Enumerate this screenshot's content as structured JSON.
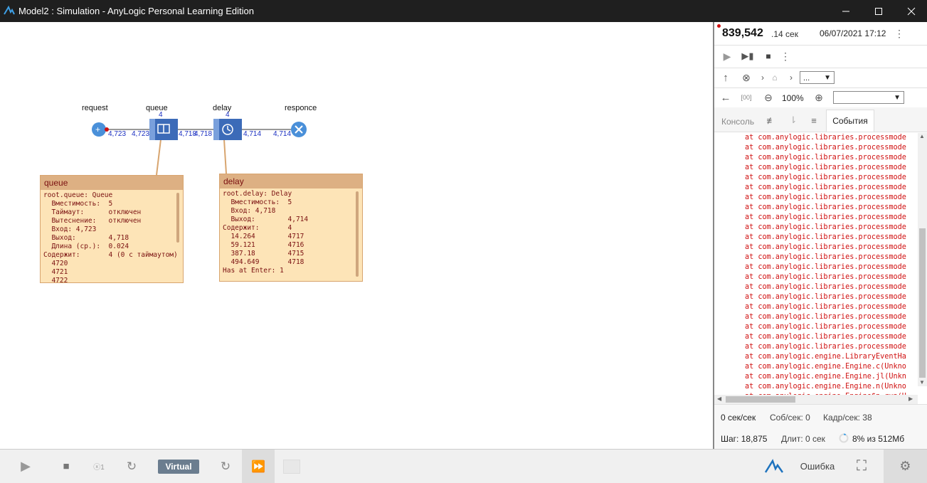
{
  "window": {
    "title": "Model2 : Simulation - AnyLogic Personal Learning Edition",
    "icon": "anylogic-logo-icon",
    "controls": [
      "minimize-icon",
      "maximize-icon",
      "close-icon"
    ]
  },
  "model": {
    "blocks": [
      {
        "id": "request",
        "label": "request",
        "out": "4,723"
      },
      {
        "id": "queue",
        "label": "queue",
        "count": "4",
        "in": "4,723",
        "out": "4,718"
      },
      {
        "id": "delay",
        "label": "delay",
        "count": "4",
        "in": "4,718",
        "out": "4,714"
      },
      {
        "id": "responce",
        "label": "responce",
        "in": "4,714"
      }
    ],
    "queue_inspect": {
      "title": "queue",
      "lines": [
        "root.queue: Queue",
        "  Вместимость:  5",
        "  Таймаут:      отключен",
        "  Вытеснение:   отключен",
        "  Вход: 4,723",
        "  Выход:        4,718",
        "  Длина (ср.):  0.024",
        "Содержит:       4 (0 с таймаутом)",
        "  4720",
        "  4721",
        "  4722"
      ]
    },
    "delay_inspect": {
      "title": "delay",
      "lines": [
        "root.delay: Delay",
        "  Вместимость:  5",
        "  Вход: 4,718",
        "  Выход:        4,714",
        "Содержит:       4",
        "  14.264        4717",
        "  59.121        4716",
        "  387.18        4715",
        "  494.649       4718",
        "Has at Enter: 1"
      ]
    }
  },
  "panel": {
    "time_value": "839,542",
    "time_unit": ".14 сек",
    "datetime": "06/07/2021 17:12",
    "zoom": "100%",
    "nav_select": "...",
    "view_select": "",
    "tab_console": "Консоль",
    "tab_events": "События",
    "console_lines": [
      "at com.anylogic.libraries.processmode",
      "at com.anylogic.libraries.processmode",
      "at com.anylogic.libraries.processmode",
      "at com.anylogic.libraries.processmode",
      "at com.anylogic.libraries.processmode",
      "at com.anylogic.libraries.processmode",
      "at com.anylogic.libraries.processmode",
      "at com.anylogic.libraries.processmode",
      "at com.anylogic.libraries.processmode",
      "at com.anylogic.libraries.processmode",
      "at com.anylogic.libraries.processmode",
      "at com.anylogic.libraries.processmode",
      "at com.anylogic.libraries.processmode",
      "at com.anylogic.libraries.processmode",
      "at com.anylogic.libraries.processmode",
      "at com.anylogic.libraries.processmode",
      "at com.anylogic.libraries.processmode",
      "at com.anylogic.libraries.processmode",
      "at com.anylogic.libraries.processmode",
      "at com.anylogic.libraries.processmode",
      "at com.anylogic.libraries.processmode",
      "at com.anylogic.libraries.processmode",
      "at com.anylogic.engine.LibraryEventHa",
      "at com.anylogic.engine.Engine.c(Unkno",
      "at com.anylogic.engine.Engine.jl(Unkn",
      "at com.anylogic.engine.Engine.n(Unkno",
      "at com.anylogic.engine.Engine$n.run(U"
    ],
    "stats": {
      "speed": "0 сек/сек",
      "events": "Соб/сек: 0",
      "frames": "Кадр/сек: 38",
      "step": "Шаг: 18,875",
      "duration": "Длит: 0 сек",
      "memory": "8% из 512Мб"
    }
  },
  "bottom": {
    "mode_label": "Virtual",
    "error_label": "Ошибка",
    "accent": "#1e73be"
  }
}
